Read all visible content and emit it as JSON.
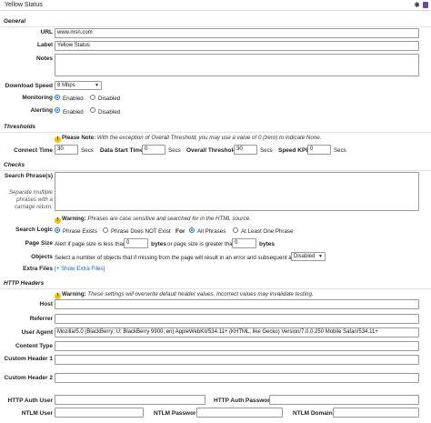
{
  "window": {
    "title": "Yellow Status",
    "pin_icon": "pin-icon",
    "delete_icon": "trash-icon"
  },
  "general": {
    "heading": "General",
    "url_label": "URL",
    "url_value": "www.msn.com",
    "label_label": "Label",
    "label_value": "Yellow Status",
    "notes_label": "Notes",
    "speed_label": "Download Speed",
    "speed_value": "8 Mbps",
    "monitoring_label": "Monitoring",
    "monitoring_options": [
      "Enabled",
      "Disabled"
    ],
    "monitoring_selected": "Enabled",
    "alerting_label": "Alerting",
    "alerting_options": [
      "Enabled",
      "Disabled"
    ],
    "alerting_selected": "Enabled"
  },
  "thresholds": {
    "heading": "Thresholds",
    "note_bold": "Please Note:",
    "note_text": "With the exception of Overall Threshold, you may use a value of 0 (zero) to indicate None.",
    "connect_label": "Connect Time",
    "connect_value": "30",
    "connect_unit": "Secs",
    "data_start_label": "Data Start Time",
    "data_start_value": "0",
    "data_start_unit": "Secs",
    "overall_label": "Overall Threshold",
    "overall_value": "30",
    "overall_unit": "Secs",
    "speed_kpi_label": "Speed KPI",
    "speed_kpi_value": "0",
    "speed_kpi_unit": "Secs"
  },
  "checks": {
    "heading": "Checks",
    "search_label": "Search Phrase(s)",
    "search_help": "Separate multiple phrases with a carriage return.",
    "warning_bold": "Warning:",
    "warning_text": "Phrases are case sensitive and searched for in the HTML source.",
    "logic_label": "Search Logic",
    "logic_options": [
      "Phrase Exists",
      "Phrase Does NOT Exist"
    ],
    "logic_selected": "Phrase Exists",
    "for_label": "For",
    "for_options": [
      "All Phrases",
      "At Least One Phrase"
    ],
    "for_selected": "All Phrases",
    "page_size_label": "Page Size",
    "page_size_less_text": "Alert if page size is less than",
    "page_size_less_value": "0",
    "page_size_less_unit": "bytes",
    "page_size_or_text": "or page size is greater than",
    "page_size_greater_value": "0",
    "page_size_greater_unit": "bytes",
    "objects_label": "Objects",
    "objects_text": "Select a number of objects that if missing from the page will result in an error and subsequent alert:",
    "objects_value": "Disabled",
    "extra_files_label": "Extra Files",
    "extra_files_link": "[+ Show Extra Files]"
  },
  "http_headers": {
    "heading": "HTTP Headers",
    "warning_bold": "Warning:",
    "warning_text": "These settings will overwrite default header values. Incorrect values may invalidate testing.",
    "host_label": "Host",
    "host_value": "",
    "referrer_label": "Referrer",
    "referrer_value": "",
    "user_agent_label": "User Agent",
    "user_agent_value": "Mozilla/5.0 (BlackBerry; U; BlackBerry 9900; en) AppleWebKit/534.11+ (KHTML, like Gecko) Version/7.0.0.250 Mobile Safari/534.11+",
    "content_type_label": "Content Type",
    "content_type_value": "",
    "custom1_label": "Custom Header 1",
    "custom1_value": "",
    "custom2_label": "Custom Header 2",
    "custom2_value": "",
    "auth_user_label": "HTTP Auth User",
    "auth_user_value": "",
    "auth_password_label": "HTTP Auth Password",
    "auth_password_value": "",
    "ntlm_user_label": "NTLM User",
    "ntlm_user_value": "",
    "ntlm_password_label": "NTLM Password",
    "ntlm_password_value": "",
    "ntlm_domain_label": "NTLM Domain",
    "ntlm_domain_value": ""
  }
}
